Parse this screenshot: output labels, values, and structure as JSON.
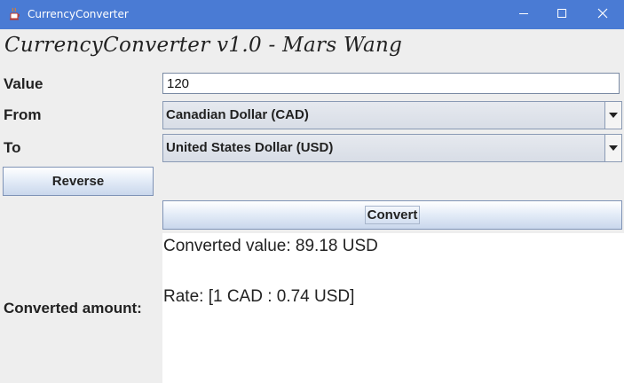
{
  "window": {
    "title": "CurrencyConverter",
    "controls": [
      "minimize",
      "maximize",
      "close"
    ]
  },
  "heading": "CurrencyConverter v1.0 - Mars Wang",
  "form": {
    "value_label": "Value",
    "value": "120",
    "from_label": "From",
    "from_selected": "Canadian Dollar (CAD)",
    "to_label": "To",
    "to_selected": "United States Dollar (USD)"
  },
  "buttons": {
    "reverse": "Reverse",
    "convert": "Convert"
  },
  "result": {
    "label": "Converted amount:",
    "converted_value": "Converted value: 89.18 USD",
    "rate": "Rate: [1 CAD : 0.74 USD]"
  },
  "colors": {
    "titlebar": "#4a7bd4",
    "window_bg": "#eeeeee",
    "result_bg": "#ffffff"
  }
}
